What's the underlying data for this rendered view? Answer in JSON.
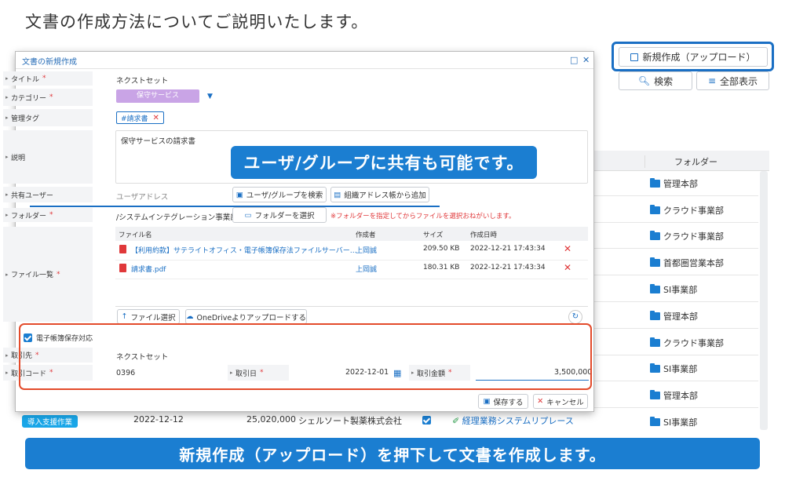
{
  "heading": "文書の作成方法についてご説明いたします。",
  "toolbar": {
    "new_upload": "新規作成（アップロード）",
    "search": "検索",
    "show_all": "全部表示"
  },
  "background_table": {
    "folder_header": "フォルダー",
    "folders": [
      "管理本部",
      "クラウド事業部",
      "クラウド事業部",
      "首都圏営業本部",
      "SI事業部",
      "管理本部",
      "クラウド事業部",
      "SI事業部",
      "管理本部",
      "SI事業部"
    ],
    "bottom_row": {
      "badge": "導入支援作業",
      "date": "2022-12-12",
      "amount": "25,020,000",
      "company": "シェルソート製薬株式会社",
      "flow": "経理業務システムリプレース"
    }
  },
  "modal": {
    "title": "文書の新規作成",
    "fields": {
      "title_label": "タイトル",
      "title_value": "ネクストセット",
      "category_label": "カテゴリー",
      "category_value": "保守サービス",
      "tag_label": "管理タグ",
      "tag_value": "#請求書",
      "desc_label": "説明",
      "desc_value": "保守サービスの請求書",
      "share_label": "共有ユーザー",
      "share_placeholder": "ユーザアドレス",
      "share_btn": "ユーザ/グループを検索",
      "addressbook_btn": "組織アドレス帳から追加",
      "folder_label": "フォルダー",
      "folder_value": "/システムインテグレーション事業部",
      "folder_btn": "フォルダーを選択",
      "folder_note": "※フォルダーを指定してからファイルを選択おねがいします。",
      "files_label": "ファイル一覧"
    },
    "file_table": {
      "headers": {
        "name": "ファイル名",
        "author": "作成者",
        "size": "サイズ",
        "date": "作成日時"
      },
      "rows": [
        {
          "name": "【利用約款】サテライトオフィス・電子帳簿保存法ファイルサーバー…",
          "author": "上岡誠",
          "size": "209.50 KB",
          "date": "2022-12-21 17:43:34"
        },
        {
          "name": "請求書.pdf",
          "author": "上岡誠",
          "size": "180.31 KB",
          "date": "2022-12-21 17:43:34"
        }
      ]
    },
    "file_select": "ファイル選択",
    "onedrive": "OneDriveよりアップロードする",
    "ebook": {
      "checkbox_label": "電子帳簿保存対応",
      "partner_label": "取引先",
      "partner_value": "ネクストセット",
      "code_label": "取引コード",
      "code_value": "0396",
      "date_label": "取引日",
      "date_value": "2022-12-01",
      "amount_label": "取引金額",
      "amount_value": "3,500,000"
    },
    "save": "保存する",
    "cancel": "キャンセル"
  },
  "callout": "ユーザ/グループに共有も可能です。",
  "banner": "新規作成（アップロード）を押下して文書を作成します。",
  "colors": {
    "accent": "#1b7ed1",
    "highlight_red": "#e34b2b",
    "required": "#e0383a"
  }
}
